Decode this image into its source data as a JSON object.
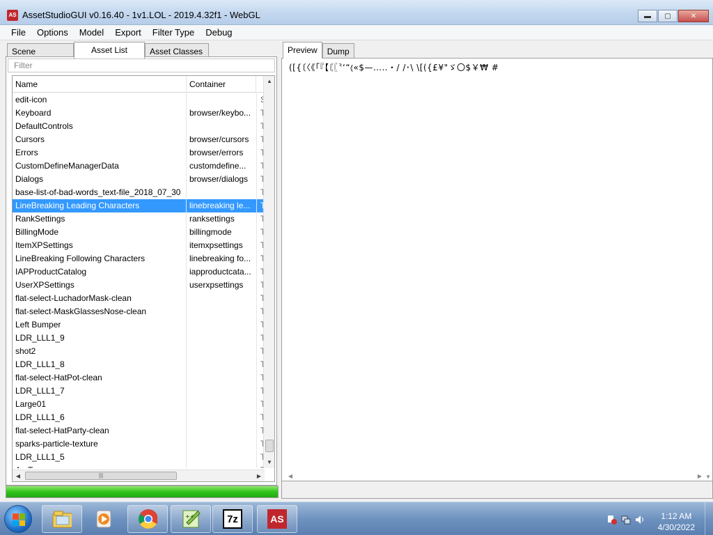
{
  "window": {
    "title": "AssetStudioGUI v0.16.40 - 1v1.LOL - 2019.4.32f1 - WebGL",
    "icon_label": "AS"
  },
  "menu": [
    "File",
    "Options",
    "Model",
    "Export",
    "Filter Type",
    "Debug"
  ],
  "left_tabs": [
    "Scene Hierarchy",
    "Asset List",
    "Asset Classes"
  ],
  "active_left_tab": "Asset List",
  "filter": {
    "placeholder": "Filter"
  },
  "columns": {
    "name": "Name",
    "container": "Container"
  },
  "rows": [
    {
      "name": "edit-icon",
      "container": "",
      "extra": "S"
    },
    {
      "name": "Keyboard",
      "container": "browser/keybo...",
      "extra": "T"
    },
    {
      "name": "DefaultControls",
      "container": "",
      "extra": "T"
    },
    {
      "name": "Cursors",
      "container": "browser/cursors",
      "extra": "T"
    },
    {
      "name": "Errors",
      "container": "browser/errors",
      "extra": "T"
    },
    {
      "name": "CustomDefineManagerData",
      "container": "customdefine...",
      "extra": "T"
    },
    {
      "name": "Dialogs",
      "container": "browser/dialogs",
      "extra": "T"
    },
    {
      "name": "base-list-of-bad-words_text-file_2018_07_30",
      "container": "",
      "extra": "T"
    },
    {
      "name": "LineBreaking Leading Characters",
      "container": "linebreaking le...",
      "extra": "T",
      "selected": true
    },
    {
      "name": "RankSettings",
      "container": "ranksettings",
      "extra": "T"
    },
    {
      "name": "BillingMode",
      "container": "billingmode",
      "extra": "T"
    },
    {
      "name": "ItemXPSettings",
      "container": "itemxpsettings",
      "extra": "T"
    },
    {
      "name": "LineBreaking Following Characters",
      "container": "linebreaking fo...",
      "extra": "T"
    },
    {
      "name": "IAPProductCatalog",
      "container": "iapproductcata...",
      "extra": "T"
    },
    {
      "name": "UserXPSettings",
      "container": "userxpsettings",
      "extra": "T"
    },
    {
      "name": "flat-select-LuchadorMask-clean",
      "container": "",
      "extra": "T"
    },
    {
      "name": "flat-select-MaskGlassesNose-clean",
      "container": "",
      "extra": "T"
    },
    {
      "name": "Left Bumper",
      "container": "",
      "extra": "T"
    },
    {
      "name": "LDR_LLL1_9",
      "container": "",
      "extra": "T"
    },
    {
      "name": "shot2",
      "container": "",
      "extra": "T"
    },
    {
      "name": "LDR_LLL1_8",
      "container": "",
      "extra": "T"
    },
    {
      "name": "flat-select-HatPot-clean",
      "container": "",
      "extra": "T"
    },
    {
      "name": "LDR_LLL1_7",
      "container": "",
      "extra": "T"
    },
    {
      "name": "Large01",
      "container": "",
      "extra": "T"
    },
    {
      "name": "LDR_LLL1_6",
      "container": "",
      "extra": "T"
    },
    {
      "name": "flat-select-HatParty-clean",
      "container": "",
      "extra": "T"
    },
    {
      "name": "sparks-particle-texture",
      "container": "",
      "extra": "T"
    },
    {
      "name": "LDR_LLL1_5",
      "container": "",
      "extra": "T"
    },
    {
      "name": "A...T...",
      "container": "",
      "extra": "T"
    }
  ],
  "progress": {
    "fraction": 1.0,
    "color": "#2fc41c"
  },
  "right_tabs": [
    "Preview",
    "Dump"
  ],
  "active_right_tab": "Preview",
  "preview_text": "([{〔〈《「『【〘〖〝‘“⦅«$—…‥・/ /･\\ \\[({£¥\"ゞ〇$￥₩ #",
  "taskbar": {
    "apps": [
      "file-explorer",
      "media-player",
      "chrome",
      "notepad-plus-plus",
      "7zip",
      "assetstudio"
    ],
    "app_7z_label": "7z",
    "app_as_label": "AS",
    "time": "1:12 AM",
    "date": "4/30/2022"
  },
  "colors": {
    "selection": "#3399ff",
    "asset_red": "#c0272d"
  }
}
